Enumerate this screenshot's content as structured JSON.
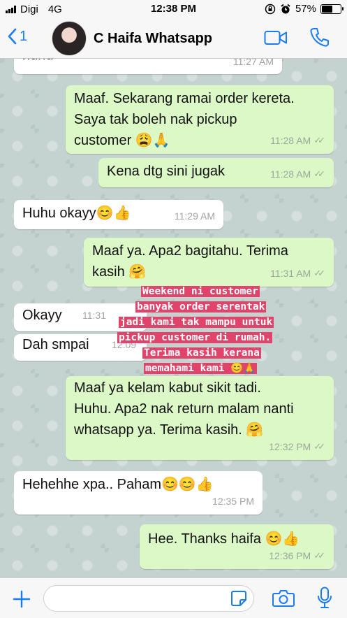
{
  "status_bar": {
    "carrier": "Digi",
    "network": "4G",
    "time": "12:38 PM",
    "battery": "57%",
    "battery_level": 0.57
  },
  "header": {
    "back_count": "1",
    "contact_name": "C Haifa Whatsapp"
  },
  "messages": [
    {
      "dir": "in",
      "text": "huhu",
      "time": "11:27 AM"
    },
    {
      "dir": "out",
      "lines": [
        "Maaf. Sekarang ramai order kereta.",
        "Saya tak boleh nak pickup",
        "customer 😩🙏"
      ],
      "time": "11:28 AM"
    },
    {
      "dir": "out",
      "text": "Kena dtg sini jugak",
      "time": "11:28 AM"
    },
    {
      "dir": "in",
      "text": "Huhu okayy😊👍",
      "time": "11:29 AM"
    },
    {
      "dir": "out",
      "lines": [
        "Maaf ya. Apa2 bagitahu. Terima",
        "kasih 🤗"
      ],
      "time": "11:31 AM"
    },
    {
      "dir": "in",
      "text": "Okayy",
      "time": "11:31"
    },
    {
      "dir": "in",
      "text": "Dah smpai",
      "time": "12:09"
    },
    {
      "dir": "out",
      "lines": [
        "Maaf ya kelam kabut sikit tadi.",
        "Huhu. Apa2 nak return malam nanti",
        "whatsapp ya. Terima kasih. 🤗"
      ],
      "time": "12:32 PM"
    },
    {
      "dir": "in",
      "text": "Hehehhe xpa.. Paham😊😊👍",
      "time": "12:35 PM"
    },
    {
      "dir": "out",
      "text": "Hee. Thanks haifa 😊👍",
      "time": "12:36 PM"
    }
  ],
  "overlay_note": {
    "lines": [
      "Weekend ni customer",
      "banyak order serentak",
      "jadi kami tak mampu untuk",
      "pickup customer di rumah.",
      "Terima kasih kerana",
      "memahami kami 😊🙏"
    ]
  },
  "input": {
    "placeholder": ""
  },
  "colors": {
    "accent": "#1a7cf5",
    "outgoing_bubble": "#dcf8c6",
    "incoming_bubble": "#ffffff",
    "overlay_highlight": "#e0446a"
  }
}
